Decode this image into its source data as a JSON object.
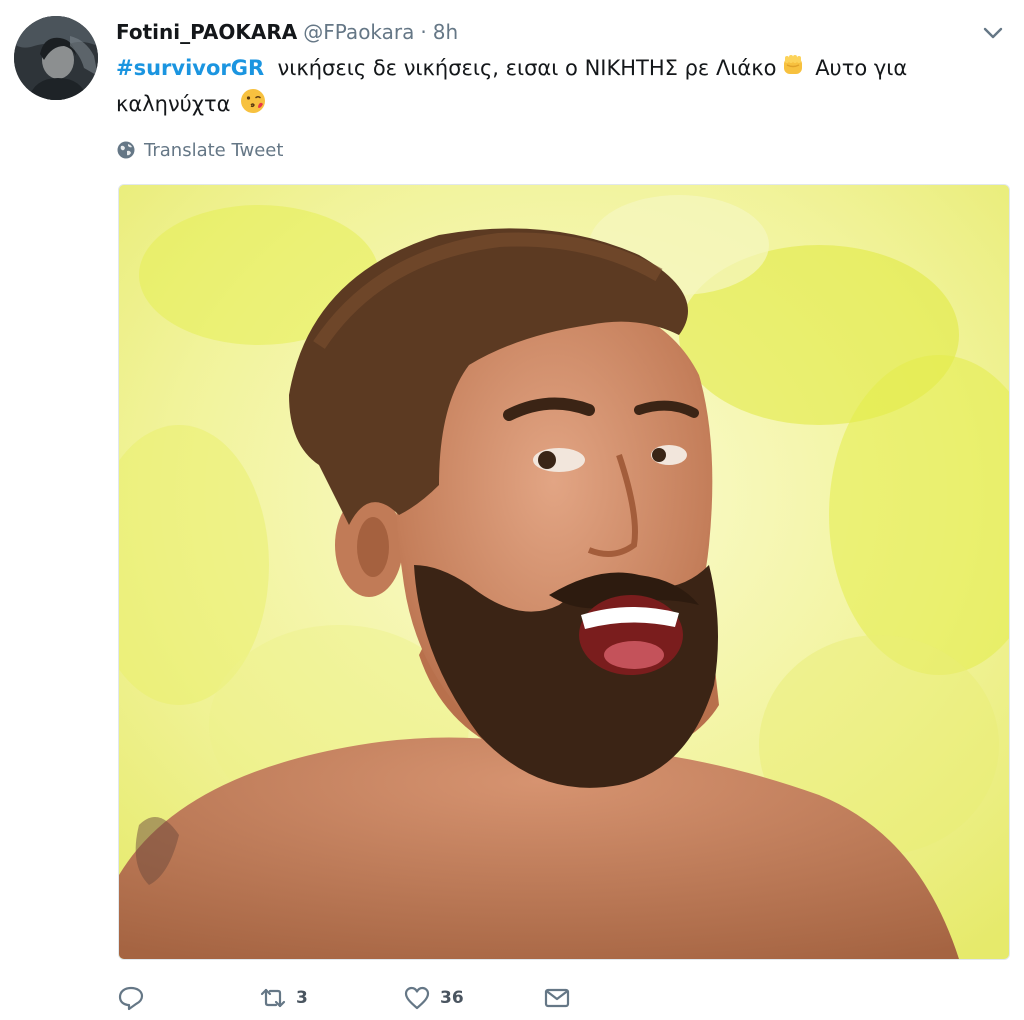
{
  "tweet": {
    "author": {
      "display_name": "Fotini_PAOKARA",
      "handle": "@FPaokara",
      "separator": "·",
      "time": "8h"
    },
    "text": {
      "hashtag": "#survivorGR",
      "part1": "νικήσεις δε νικήσεις, εισαι ο ΝΙΚΗΤΗΣ ρε Λιάκο",
      "emoji1": "fist-emoji",
      "part2": "Αυτο για",
      "part3": "καληνύχτα",
      "emoji2": "kissing-face-emoji"
    },
    "translate_label": "Translate Tweet",
    "actions": {
      "reply_count": "",
      "retweet_count": "3",
      "like_count": "36"
    }
  },
  "icons": {
    "reply": "reply-icon",
    "retweet": "retweet-icon",
    "like": "heart-icon",
    "dm": "envelope-icon",
    "globe": "globe-icon",
    "caret": "chevron-down-icon"
  },
  "colors": {
    "link": "#1b95e0",
    "muted": "#657786",
    "text": "#14171a"
  }
}
